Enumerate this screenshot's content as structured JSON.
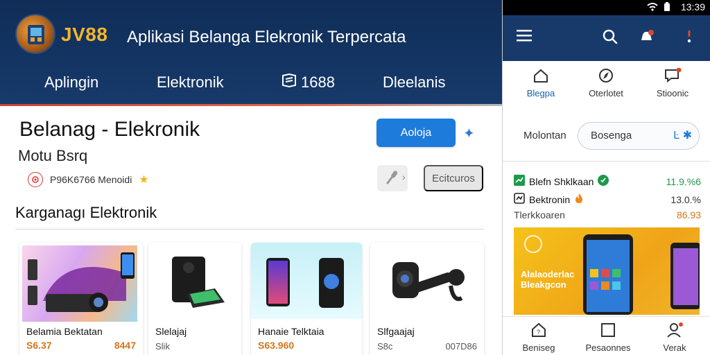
{
  "header": {
    "brand": "JV88",
    "title": "Aplikasi Belanga Elekronik Terpercata",
    "nav": [
      {
        "label": "Aplingin"
      },
      {
        "label": "Elektronik"
      },
      {
        "label": "1688",
        "icon": "book-icon"
      },
      {
        "label": "Dleelanis"
      }
    ]
  },
  "main": {
    "title": "Belanag - Elekronik",
    "subtitle": "Motu Bsrq",
    "seller": {
      "text": "P96K6766 Menoidi",
      "star": "★"
    },
    "primary_button": "Aoloja",
    "secondary_button": "Ecitcuros",
    "section_title": "Karganagı Elektronik"
  },
  "products": [
    {
      "name": "Belamia Bektatan",
      "price": "S6.37",
      "price2": "8447"
    },
    {
      "name": "Slelajaj",
      "meta": "Slik"
    },
    {
      "name": "Hanaie Telktaia",
      "price": "S63.960"
    },
    {
      "name": "Slfgaajaj",
      "meta": "S8c",
      "meta2": "007D86"
    }
  ],
  "phone": {
    "status_time": "13:39",
    "tabs": [
      {
        "label": "Blegpa",
        "icon": "home-icon",
        "active": true
      },
      {
        "label": "Oterlotet",
        "icon": "compass-icon"
      },
      {
        "label": "Stioonic",
        "icon": "message-icon"
      }
    ],
    "search": {
      "label": "Molontan",
      "value": "Bosenga"
    },
    "stats": [
      {
        "label": "Blefn Shklkaan",
        "value": "11.9.%6"
      },
      {
        "label": "Bektronin",
        "value": "13.0.%"
      },
      {
        "label": "Tlerkkoaren",
        "value": "86.93"
      }
    ],
    "promo": {
      "line1": "Alalaoderlac",
      "line2": "Bleakgcon"
    },
    "bottom_nav": [
      {
        "label": "Beniseg",
        "icon": "house-icon"
      },
      {
        "label": "Pesaonnes",
        "icon": "square-icon"
      },
      {
        "label": "Verak",
        "icon": "user-icon"
      }
    ]
  },
  "colors": {
    "header": "#173a6b",
    "accent": "#1d7bdc",
    "brand": "#f6b52a",
    "price": "#d4761a",
    "positive": "#1c9a4a"
  }
}
